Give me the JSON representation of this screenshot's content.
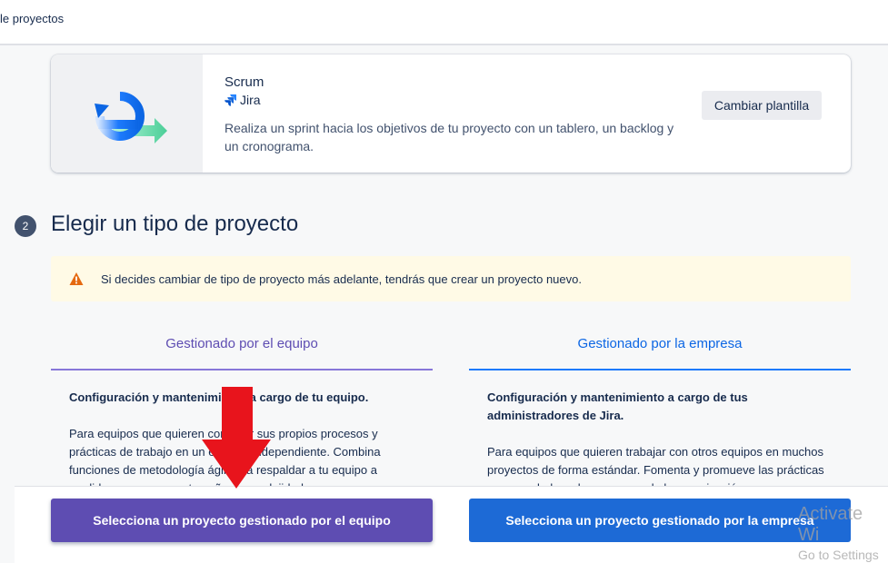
{
  "header": {
    "breadcrumb": "le proyectos"
  },
  "template": {
    "name": "Scrum",
    "product": "Jira",
    "description": "Realiza un sprint hacia los objetivos de tu proyecto con un tablero, un backlog y un cronograma.",
    "change_button": "Cambiar plantilla"
  },
  "step": {
    "number": "2",
    "title": "Elegir un tipo de proyecto"
  },
  "warning": {
    "text": "Si decides cambiar de tipo de proyecto más adelante, tendrás que crear un proyecto nuevo."
  },
  "tabs": [
    {
      "label": "Gestionado por el equipo"
    },
    {
      "label": "Gestionado por la empresa"
    }
  ],
  "team": {
    "heading": "Configuración y mantenimiento a cargo de tu equipo.",
    "body": "Para equipos que quieren controlar sus propios procesos y prácticas de trabajo en un espacio independiente. Combina funciones de metodología ágil para respaldar a tu equipo a medida que crezca en tamaño y complejidad.",
    "button": "Selecciona un proyecto gestionado por el equipo"
  },
  "company": {
    "heading": "Configuración y mantenimiento a cargo de tus administradores de Jira.",
    "body": "Para equipos que quieren trabajar con otros equipos en muchos proyectos de forma estándar. Fomenta y promueve las prácticas recomendadas y los procesos de la organización.",
    "button": "Selecciona un proyecto gestionado por la empresa"
  },
  "watermark": {
    "line1": "Activate Wi",
    "line2": "Go to Settings"
  },
  "colors": {
    "team_accent": "#5e4db2",
    "company_accent": "#1d6ad6",
    "warning_bg": "#fffae6",
    "arrow": "#e8141c"
  }
}
